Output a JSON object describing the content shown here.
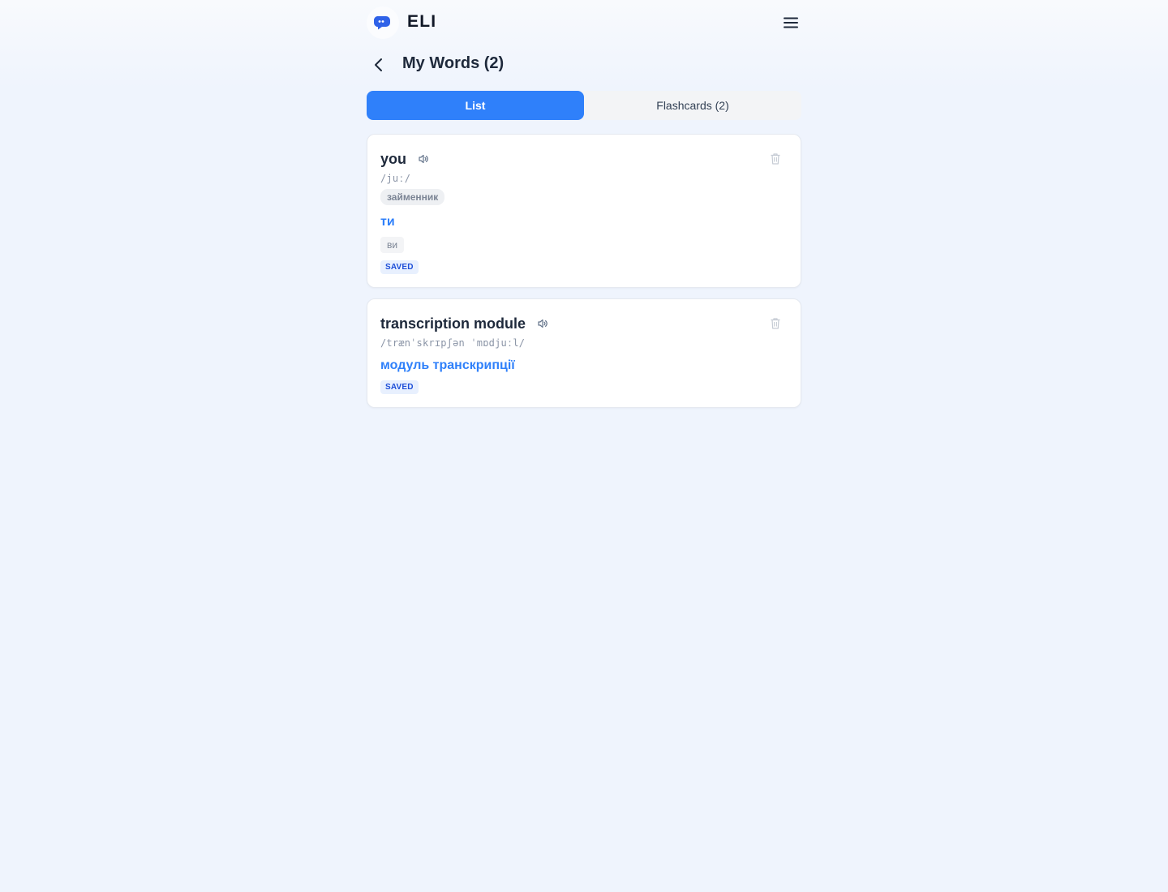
{
  "app": {
    "name": "ELI"
  },
  "header": {
    "title": "My Words (2)"
  },
  "tabs": [
    {
      "label": "List",
      "active": true
    },
    {
      "label": "Flashcards (2)",
      "active": false
    }
  ],
  "words": [
    {
      "word": "you",
      "ipa": "/juː/",
      "part_of_speech": "займенник",
      "translation": "ти",
      "alternatives": [
        "ви"
      ],
      "status": "SAVED"
    },
    {
      "word": "transcription module",
      "ipa": "/trænˈskrɪpʃən ˈmɒdjuːl/",
      "translation": "модуль транскрипції",
      "status": "SAVED"
    }
  ],
  "colors": {
    "accent": "#2f80fa",
    "saved_badge_bg": "#e8f0fe",
    "saved_badge_text": "#1d4ed8",
    "page_bg": "#eff4fd"
  },
  "icons": {
    "logo": "chat-bubble-icon",
    "menu": "hamburger-menu-icon",
    "back": "chevron-left-icon",
    "speak": "speaker-icon",
    "delete": "trash-icon"
  }
}
